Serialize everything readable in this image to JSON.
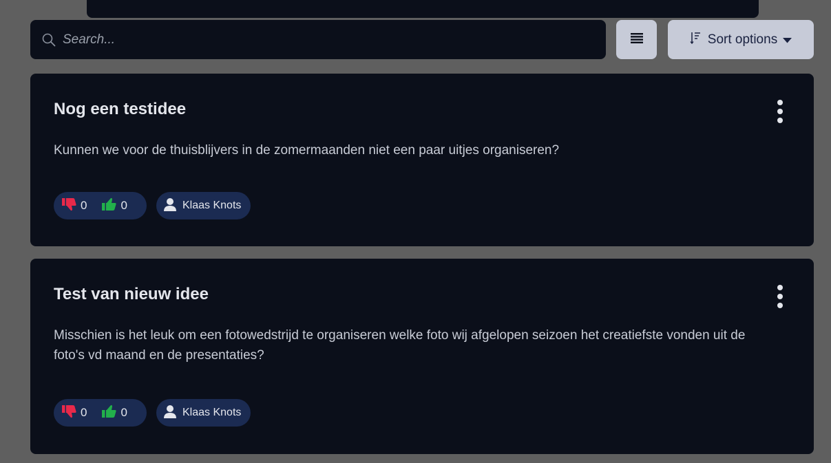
{
  "search": {
    "placeholder": "Search..."
  },
  "toolbar": {
    "sort_label": "Sort options"
  },
  "ideas": [
    {
      "title": "Nog een testidee",
      "description": "Kunnen we voor de thuisblijvers in de zomermaanden niet een paar uitjes organiseren?",
      "downvotes": "0",
      "upvotes": "0",
      "author": "Klaas Knots"
    },
    {
      "title": "Test van nieuw idee",
      "description": "Misschien is het leuk om een fotowedstrijd te organiseren welke foto wij afgelopen seizoen het creatiefste vonden uit de foto's vd maand en de presentaties?",
      "downvotes": "0",
      "upvotes": "0",
      "author": "Klaas Knots"
    }
  ],
  "colors": {
    "background": "#5f5f5f",
    "card": "#0b0f1a",
    "pill": "#1b2b52",
    "button": "#c7cbd8",
    "thumbs_down": "#e8294a",
    "thumbs_up": "#22b04b"
  },
  "icons": {
    "search": "search-icon",
    "list": "list-view-icon",
    "sort": "sort-icon",
    "dropdown": "caret-down-icon",
    "menu": "kebab-menu-icon",
    "downvote": "thumbs-down-icon",
    "upvote": "thumbs-up-icon",
    "author": "user-icon"
  }
}
